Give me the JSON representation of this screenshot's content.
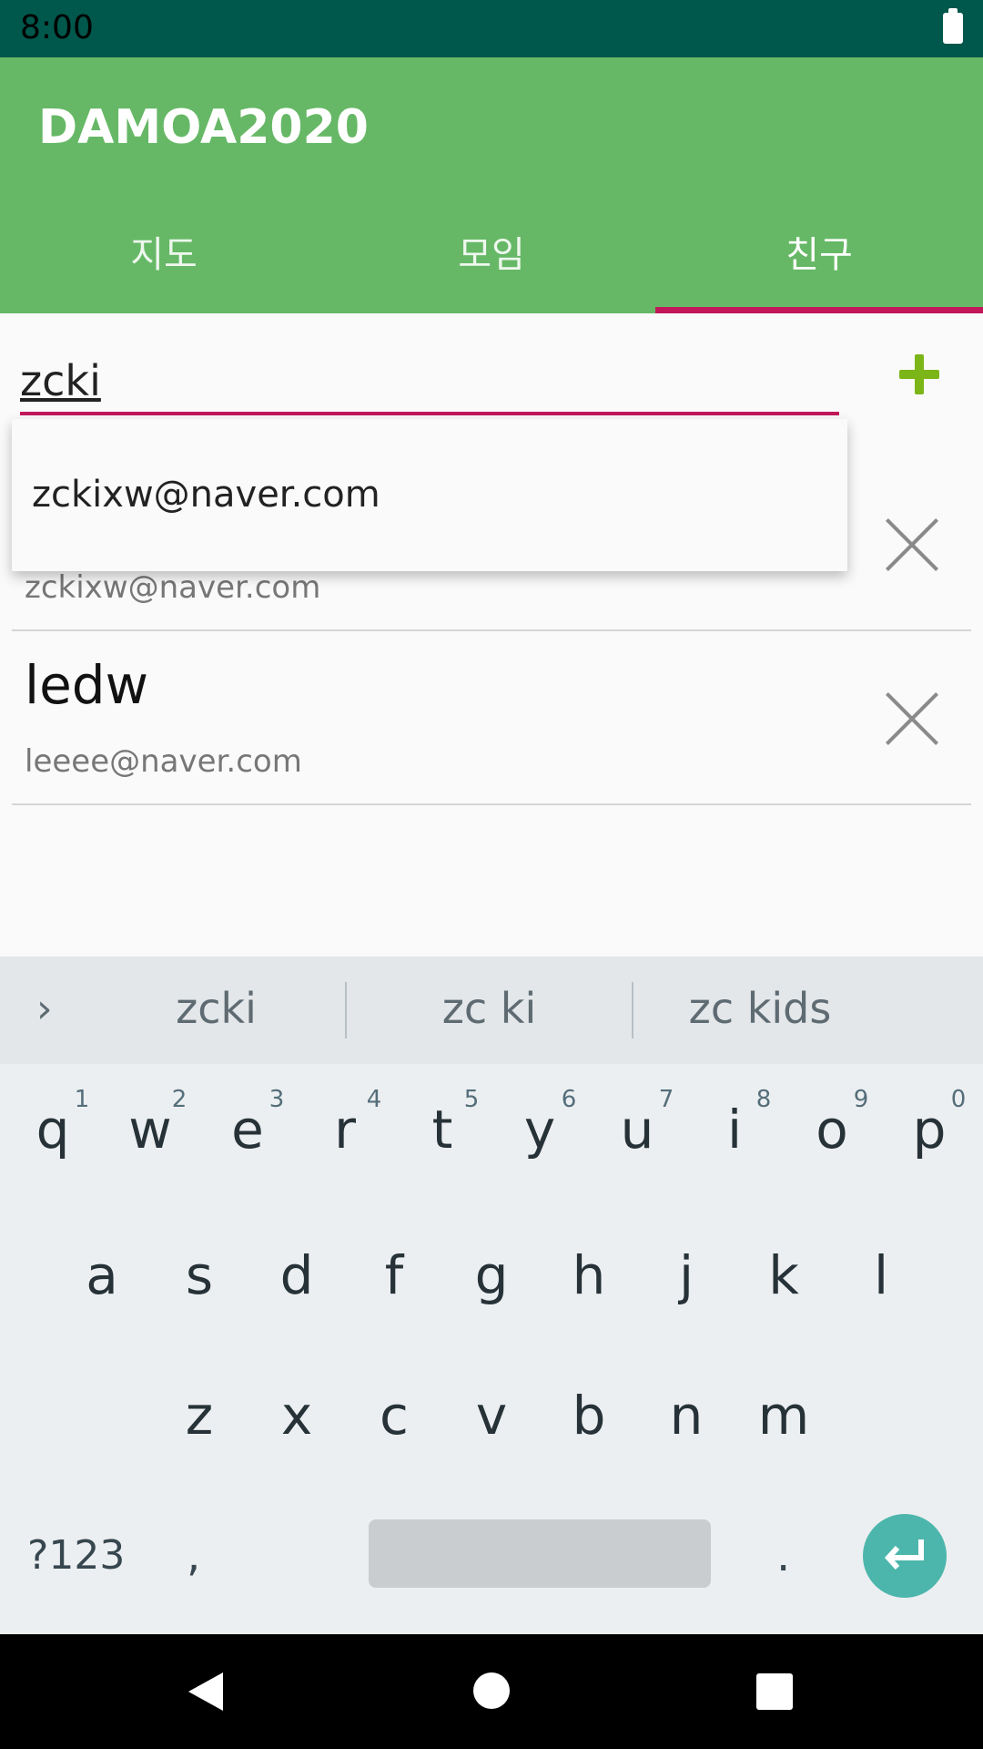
{
  "status_bar": {
    "time": "8:00"
  },
  "app_bar": {
    "title": "DAMOA2020"
  },
  "tabs": [
    {
      "label": "지도"
    },
    {
      "label": "모임"
    },
    {
      "label": "친구"
    }
  ],
  "search": {
    "value": "zcki"
  },
  "autocomplete": {
    "items": [
      "zckixw@naver.com"
    ]
  },
  "friends": [
    {
      "name": "",
      "email": "zckixw@naver.com"
    },
    {
      "name": "ledw",
      "email": "leeee@naver.com"
    }
  ],
  "keyboard": {
    "suggestions": [
      "zcki",
      "zc ki",
      "zc kids"
    ],
    "row1": [
      "q",
      "w",
      "e",
      "r",
      "t",
      "y",
      "u",
      "i",
      "o",
      "p"
    ],
    "row1_numbers": [
      "1",
      "2",
      "3",
      "4",
      "5",
      "6",
      "7",
      "8",
      "9",
      "0"
    ],
    "row2": [
      "a",
      "s",
      "d",
      "f",
      "g",
      "h",
      "j",
      "k",
      "l"
    ],
    "row3": [
      "z",
      "x",
      "c",
      "v",
      "b",
      "n",
      "m"
    ],
    "symbols_label": "?123",
    "comma": ",",
    "period": "."
  },
  "colors": {
    "status_bar": "#00574b",
    "app_bar": "#66b866",
    "accent": "#c2185b",
    "add_icon": "#7cb518",
    "enter_key": "#4db6ac"
  }
}
